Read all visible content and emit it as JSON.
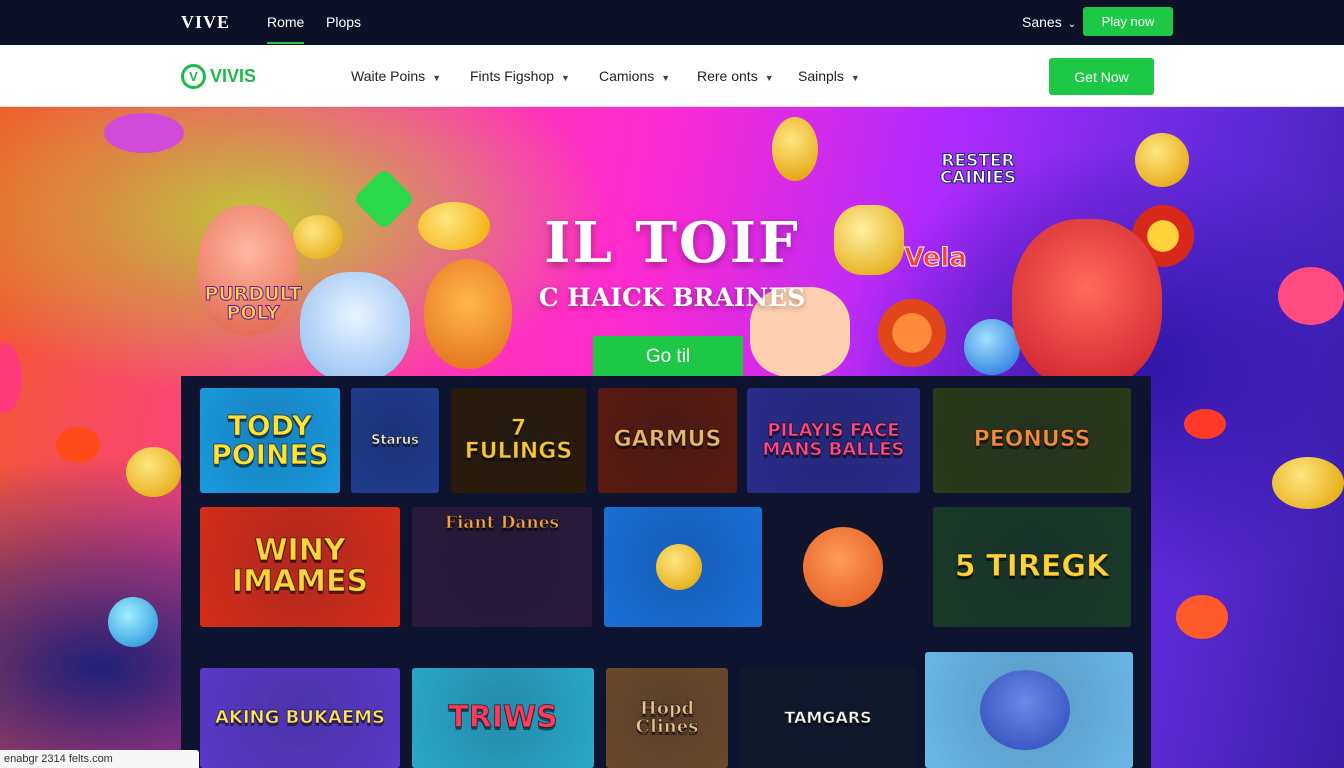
{
  "topbar": {
    "brand": "VIVE",
    "nav": [
      {
        "label": "Rome",
        "active": true
      },
      {
        "label": "Plops",
        "active": false
      }
    ],
    "language": "Sanes",
    "play_button": "Play now"
  },
  "mainnav": {
    "logo_text": "VIVIS",
    "items": [
      "Waite Poins",
      "Fints Figshop",
      "Camions",
      "Rere onts",
      "Sainpls"
    ],
    "cta": "Get Now"
  },
  "hero": {
    "title": "IL TOIF",
    "subtitle": "C HAICK BRAINES",
    "cta": "Go til",
    "badges": {
      "left_logo": "PURDULT POLY",
      "right_logo": "RESTER CAINIES",
      "vlabel": "Vela"
    }
  },
  "games": [
    {
      "title": "TODY POINES",
      "text_color": "#ffe23a",
      "bg": "#1a9be0"
    },
    {
      "title": "Starus",
      "text_color": "#ffffff",
      "bg": "#203c8c"
    },
    {
      "title": "7 FULINGS",
      "text_color": "#f6c53a",
      "bg": "#2a1b0a"
    },
    {
      "title": "GARMUS",
      "text_color": "#e8b76a",
      "bg": "#5a1a10"
    },
    {
      "title": "PILAYIS FACE MANS BALLES",
      "text_color": "#ff4a8a",
      "bg": "#2a2c8a"
    },
    {
      "title": "PEONUSS",
      "text_color": "#f38b3a",
      "bg": "#2a3a1a"
    },
    {
      "title": "WINY IMAMES",
      "text_color": "#ffd33a",
      "bg": "#d52e1a"
    },
    {
      "title": "Fiant Danes",
      "text_color": "#f5a34a",
      "bg": "#2a1a3a"
    },
    {
      "title": "",
      "text_color": "#ffffff",
      "bg": "#1a6fd8"
    },
    {
      "title": "",
      "text_color": "#ffffff",
      "bg": "#10142c"
    },
    {
      "title": "5 TIREGK",
      "text_color": "#ffd23a",
      "bg": "#1a3a28"
    },
    {
      "title": "AKING BUKAEMS",
      "text_color": "#ffe46a",
      "bg": "#5a3ac8"
    },
    {
      "title": "TRIWS",
      "text_color": "#ff3a5a",
      "bg": "#2aa8c8"
    },
    {
      "title": "Hopd Clines",
      "text_color": "#e8c08a",
      "bg": "#6a4a2a"
    },
    {
      "title": "TAMGARS",
      "text_color": "#ffffff",
      "bg": "#101a2a"
    },
    {
      "title": "",
      "text_color": "#ffffff",
      "bg": "#6ab8e8"
    }
  ],
  "footer_note": "enabgr 2314 felts.com"
}
